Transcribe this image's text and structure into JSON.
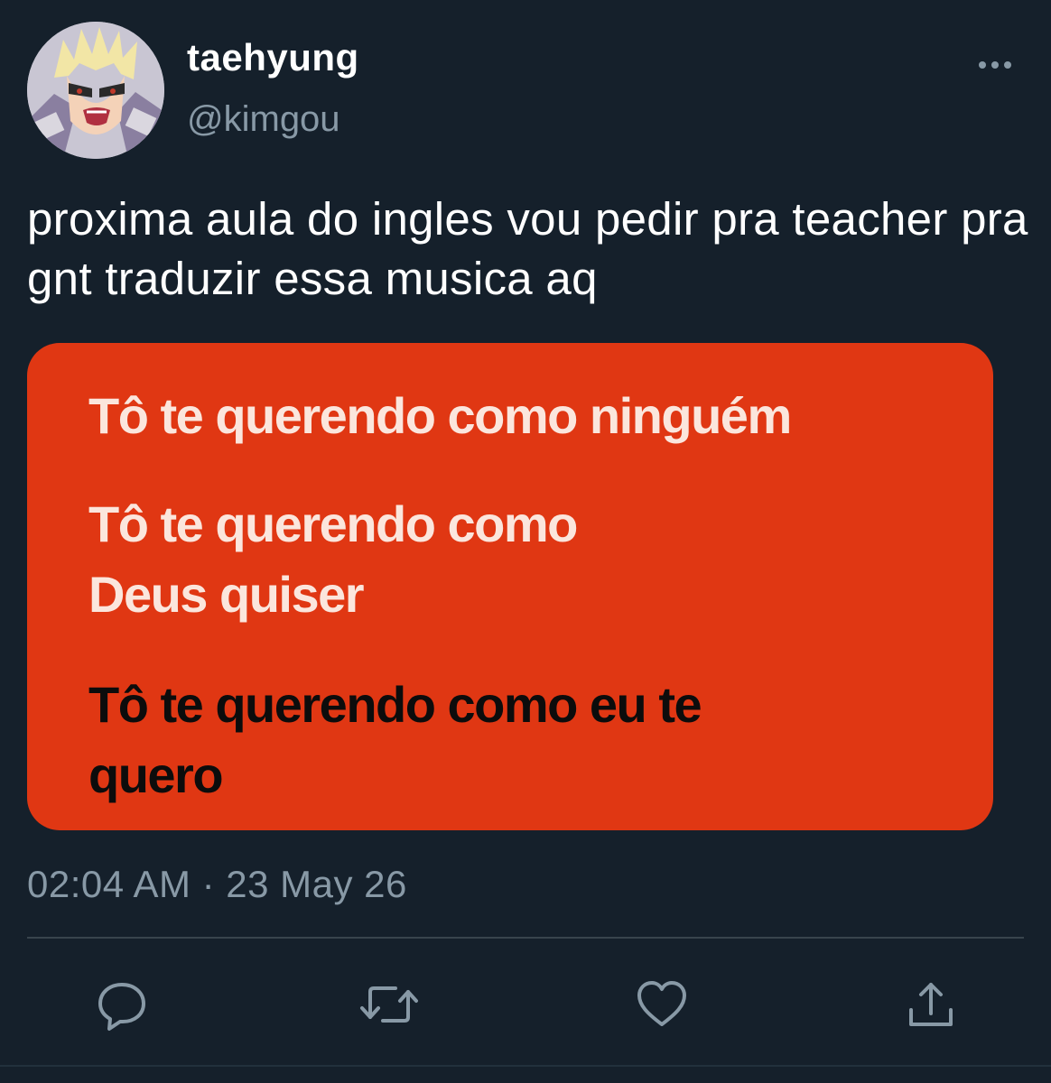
{
  "user": {
    "display_name": "taehyung",
    "handle": "@kimgou"
  },
  "tweet": {
    "text": "proxima aula do ingles vou pedir pra teacher pra gnt traduzir essa musica aq",
    "timestamp": "02:04 AM · 23 May 26"
  },
  "media": {
    "background_color": "#e03713",
    "lyrics": [
      "Tô te querendo como ninguém",
      "Tô te querendo como Deus quiser",
      "Tô te querendo como eu te quero"
    ]
  },
  "icons": {
    "more": "more-dots-icon",
    "reply": "reply-icon",
    "retweet": "retweet-icon",
    "like": "heart-icon",
    "share": "share-icon"
  },
  "colors": {
    "background": "#15202b",
    "secondary_text": "#8899a6",
    "divider": "#38444d"
  }
}
